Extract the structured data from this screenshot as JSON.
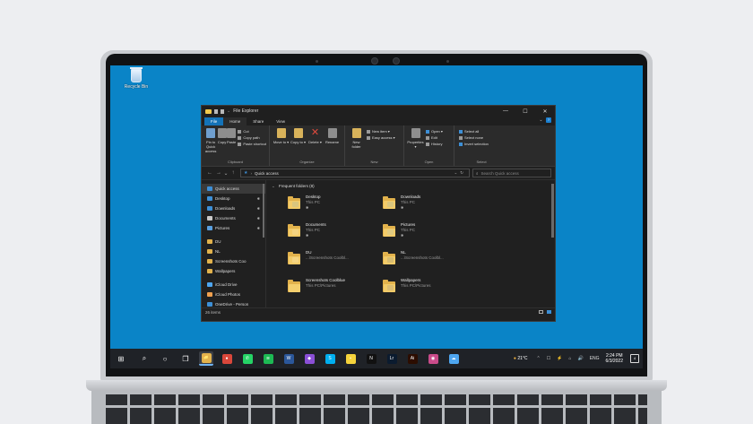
{
  "desktop": {
    "recycle_bin_label": "Recycle Bin"
  },
  "window": {
    "title": "File Explorer",
    "controls": {
      "minimize": "—",
      "maximize": "☐",
      "close": "✕"
    },
    "tabs": [
      "File",
      "Home",
      "Share",
      "View"
    ],
    "tabs_right_chevron": "⌄",
    "help": "?"
  },
  "ribbon": {
    "clipboard": {
      "name": "Clipboard",
      "pin": "Pin to Quick access",
      "copy": "Copy",
      "paste": "Paste",
      "cut": "Cut",
      "copy_path": "Copy path",
      "paste_shortcut": "Paste shortcut"
    },
    "organize": {
      "name": "Organize",
      "move_to": "Move to ▾",
      "copy_to": "Copy to ▾",
      "delete": "Delete ▾",
      "rename": "Rename"
    },
    "new": {
      "name": "New",
      "new_folder": "New folder",
      "new_item": "New item ▾",
      "easy_access": "Easy access ▾"
    },
    "open": {
      "name": "Open",
      "properties": "Properties ▾",
      "open": "Open ▾",
      "edit": "Edit",
      "history": "History"
    },
    "select": {
      "name": "Select",
      "select_all": "Select all",
      "select_none": "Select none",
      "invert": "Invert selection"
    }
  },
  "address": {
    "back": "←",
    "forward": "→",
    "recent": "⌄",
    "up": "↑",
    "path": "Quick access",
    "dropdown": "⌄",
    "refresh": "↻",
    "search_placeholder": "Search Quick access"
  },
  "nav_pane": {
    "items": [
      {
        "label": "Quick access",
        "color": "#3d8fd6",
        "pinned": false
      },
      {
        "label": "Desktop",
        "color": "#3d8fd6",
        "pinned": true
      },
      {
        "label": "Downloads",
        "color": "#3d8fd6",
        "pinned": true
      },
      {
        "label": "Documents",
        "color": "#c9c9c9",
        "pinned": true
      },
      {
        "label": "Pictures",
        "color": "#5aa0e0",
        "pinned": true
      },
      {
        "label": "DU",
        "color": "#e2b24c",
        "pinned": false
      },
      {
        "label": "NL",
        "color": "#e2b24c",
        "pinned": false
      },
      {
        "label": "Screenshots Coo",
        "color": "#e2b24c",
        "pinned": false
      },
      {
        "label": "Wallpapers",
        "color": "#e2b24c",
        "pinned": false
      },
      {
        "label": "iCloud Drive",
        "color": "#4ea6f0",
        "pinned": false
      },
      {
        "label": "iCloud Photos",
        "color": "#f0a04e",
        "pinned": false
      },
      {
        "label": "OneDrive - Person",
        "color": "#3d8fd6",
        "pinned": false
      }
    ]
  },
  "content": {
    "section_title": "Frequent folders (8)",
    "folders": [
      {
        "name": "Desktop",
        "location": "This PC",
        "pinned": true,
        "badge": "#3d8fd6"
      },
      {
        "name": "Downloads",
        "location": "This PC",
        "pinned": true,
        "badge": "#3d8fd6"
      },
      {
        "name": "Documents",
        "location": "This PC",
        "pinned": true,
        "badge": "#e8e8e8"
      },
      {
        "name": "Pictures",
        "location": "This PC",
        "pinned": true,
        "badge": "#6fb3f2"
      },
      {
        "name": "DU",
        "location": "...\\Screenshots Coolbl...",
        "pinned": false,
        "badge": "#f4f4f4"
      },
      {
        "name": "NL",
        "location": "...\\Screenshots Coolbl...",
        "pinned": false,
        "badge": "#2f4f7a"
      },
      {
        "name": "Screenshots Coolblue",
        "location": "This PC\\Pictures",
        "pinned": false,
        "badge": ""
      },
      {
        "name": "Wallpapers",
        "location": "This PC\\Pictures",
        "pinned": false,
        "badge": "#4a5a8a"
      }
    ],
    "pin_glyph": "📌"
  },
  "status": {
    "items": "26 items"
  },
  "taskbar": {
    "start": "⊞",
    "search": "⌕",
    "cortana": "○",
    "taskview": "❐",
    "apps": [
      {
        "name": "file-explorer",
        "glyph": "📁",
        "bg": "#e2b24c",
        "active": true
      },
      {
        "name": "chrome",
        "glyph": "●",
        "bg": "#d9473b",
        "active": false
      },
      {
        "name": "whatsapp",
        "glyph": "✆",
        "bg": "#25d366",
        "active": false
      },
      {
        "name": "spotify",
        "glyph": "≋",
        "bg": "#1db954",
        "active": false
      },
      {
        "name": "word",
        "glyph": "W",
        "bg": "#2b579a",
        "active": false
      },
      {
        "name": "drops",
        "glyph": "◆",
        "bg": "#8a4fd6",
        "active": false
      },
      {
        "name": "skype",
        "glyph": "S",
        "bg": "#00aff0",
        "active": false
      },
      {
        "name": "sticky-notes",
        "glyph": "▪",
        "bg": "#f5d33b",
        "active": false
      },
      {
        "name": "netflix",
        "glyph": "N",
        "bg": "#111111",
        "active": false
      },
      {
        "name": "lightroom",
        "glyph": "Lr",
        "bg": "#0b1b2f",
        "active": false
      },
      {
        "name": "illustrator",
        "glyph": "Ai",
        "bg": "#2c0d00",
        "active": false
      },
      {
        "name": "teams",
        "glyph": "◉",
        "bg": "#c94b8a",
        "active": false
      },
      {
        "name": "icloud",
        "glyph": "☁",
        "bg": "#4ea6f0",
        "active": false
      }
    ],
    "weather": "21°C",
    "tray": [
      "⌃",
      "☐",
      "⚡",
      "⌂",
      "🔊",
      "ENG"
    ],
    "time": "2:24 PM",
    "date": "6/3/2022",
    "notifications": "4"
  }
}
